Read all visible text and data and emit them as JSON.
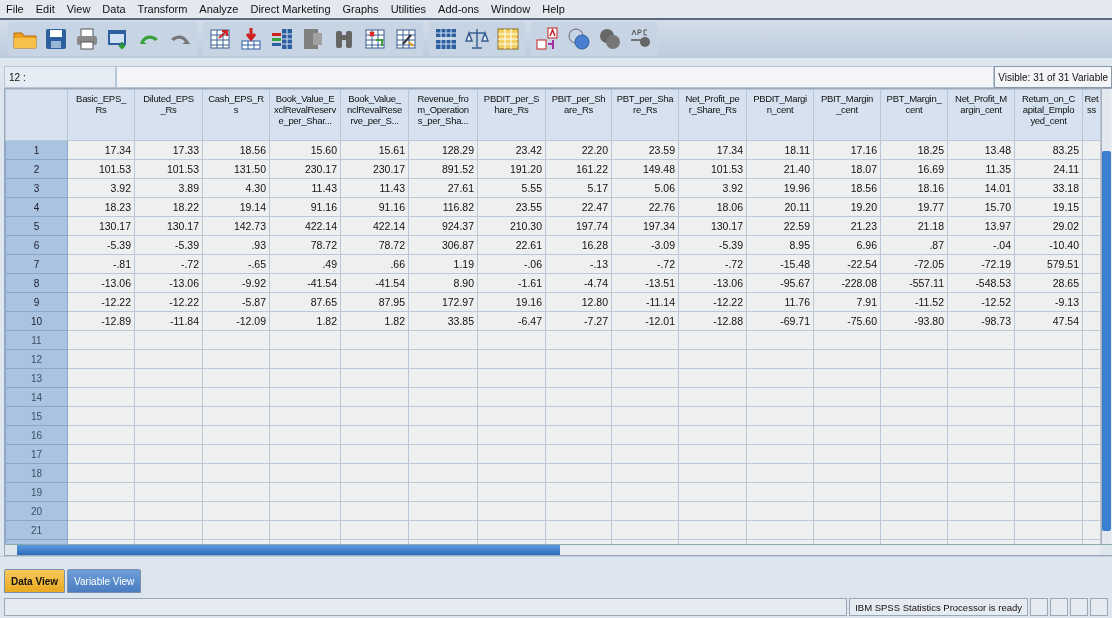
{
  "menu": [
    "File",
    "Edit",
    "View",
    "Data",
    "Transform",
    "Analyze",
    "Direct Marketing",
    "Graphs",
    "Utilities",
    "Add-ons",
    "Window",
    "Help"
  ],
  "cell_editor": {
    "case_label": "12 :",
    "visible_label": "Visible: 31 of 31 Variable"
  },
  "table": {
    "columns": [
      "Basic_EPS_\nRs",
      "Diluted_EPS\n_Rs",
      "Cash_EPS_R\ns",
      "Book_Value_E\nxclRevalReserv\ne_per_Shar...",
      "Book_Value_\nnclRevalRese\nrve_per_S...",
      "Revenue_fro\nm_Operation\ns_per_Sha...",
      "PBDIT_per_S\nhare_Rs",
      "PBIT_per_Sh\nare_Rs",
      "PBT_per_Sha\nre_Rs",
      "Net_Profit_pe\nr_Share_Rs",
      "PBDIT_Margi\nn_cent",
      "PBIT_Margin\n_cent",
      "PBT_Margin_\ncent",
      "Net_Profit_M\nargin_cent",
      "Return_on_C\napital_Emplo\nyed_cent",
      "Ret\nss"
    ],
    "rows": [
      {
        "label": "1",
        "cells": [
          "17.34",
          "17.33",
          "18.56",
          "15.60",
          "15.61",
          "128.29",
          "23.42",
          "22.20",
          "23.59",
          "17.34",
          "18.11",
          "17.16",
          "18.25",
          "13.48",
          "83.25"
        ]
      },
      {
        "label": "2",
        "cells": [
          "101.53",
          "101.53",
          "131.50",
          "230.17",
          "230.17",
          "891.52",
          "191.20",
          "161.22",
          "149.48",
          "101.53",
          "21.40",
          "18.07",
          "16.69",
          "11.35",
          "24.11"
        ]
      },
      {
        "label": "3",
        "cells": [
          "3.92",
          "3.89",
          "4.30",
          "11.43",
          "11.43",
          "27.61",
          "5.55",
          "5.17",
          "5.06",
          "3.92",
          "19.96",
          "18.56",
          "18.16",
          "14.01",
          "33.18"
        ]
      },
      {
        "label": "4",
        "cells": [
          "18.23",
          "18.22",
          "19.14",
          "91.16",
          "91.16",
          "116.82",
          "23.55",
          "22.47",
          "22.76",
          "18.06",
          "20.11",
          "19.20",
          "19.77",
          "15.70",
          "19.15"
        ]
      },
      {
        "label": "5",
        "cells": [
          "130.17",
          "130.17",
          "142.73",
          "422.14",
          "422.14",
          "924.37",
          "210.30",
          "197.74",
          "197.34",
          "130.17",
          "22.59",
          "21.23",
          "21.18",
          "13.97",
          "29.02"
        ]
      },
      {
        "label": "6",
        "cells": [
          "-5.39",
          "-5.39",
          ".93",
          "78.72",
          "78.72",
          "306.87",
          "22.61",
          "16.28",
          "-3.09",
          "-5.39",
          "8.95",
          "6.96",
          ".87",
          "-.04",
          "-10.40"
        ]
      },
      {
        "label": "7",
        "cells": [
          "-.81",
          "-.72",
          "-.65",
          ".49",
          ".66",
          "1.19",
          "-.06",
          "-.13",
          "-.72",
          "-.72",
          "-15.48",
          "-22.54",
          "-72.05",
          "-72.19",
          "579.51"
        ]
      },
      {
        "label": "8",
        "cells": [
          "-13.06",
          "-13.06",
          "-9.92",
          "-41.54",
          "-41.54",
          "8.90",
          "-1.61",
          "-4.74",
          "-13.51",
          "-13.06",
          "-95.67",
          "-228.08",
          "-557.11",
          "-548.53",
          "28.65"
        ]
      },
      {
        "label": "9",
        "cells": [
          "-12.22",
          "-12.22",
          "-5.87",
          "87.65",
          "87.95",
          "172.97",
          "19.16",
          "12.80",
          "-11.14",
          "-12.22",
          "11.76",
          "7.91",
          "-11.52",
          "-12.52",
          "-9.13"
        ]
      },
      {
        "label": "10",
        "cells": [
          "-12.89",
          "-11.84",
          "-12.09",
          "1.82",
          "1.82",
          "33.85",
          "-6.47",
          "-7.27",
          "-12.01",
          "-12.88",
          "-69.71",
          "-75.60",
          "-93.80",
          "-98.73",
          "47.54"
        ]
      },
      {
        "label": "11"
      },
      {
        "label": "12"
      },
      {
        "label": "13"
      },
      {
        "label": "14"
      },
      {
        "label": "15"
      },
      {
        "label": "16"
      },
      {
        "label": "17"
      },
      {
        "label": "18"
      },
      {
        "label": "19"
      },
      {
        "label": "20"
      },
      {
        "label": "21"
      }
    ]
  },
  "view_tabs": [
    {
      "label": "Data View",
      "selected": true
    },
    {
      "label": "Variable View",
      "selected": false
    }
  ],
  "status_bar": {
    "message": "IBM SPSS Statistics Processor is ready"
  }
}
